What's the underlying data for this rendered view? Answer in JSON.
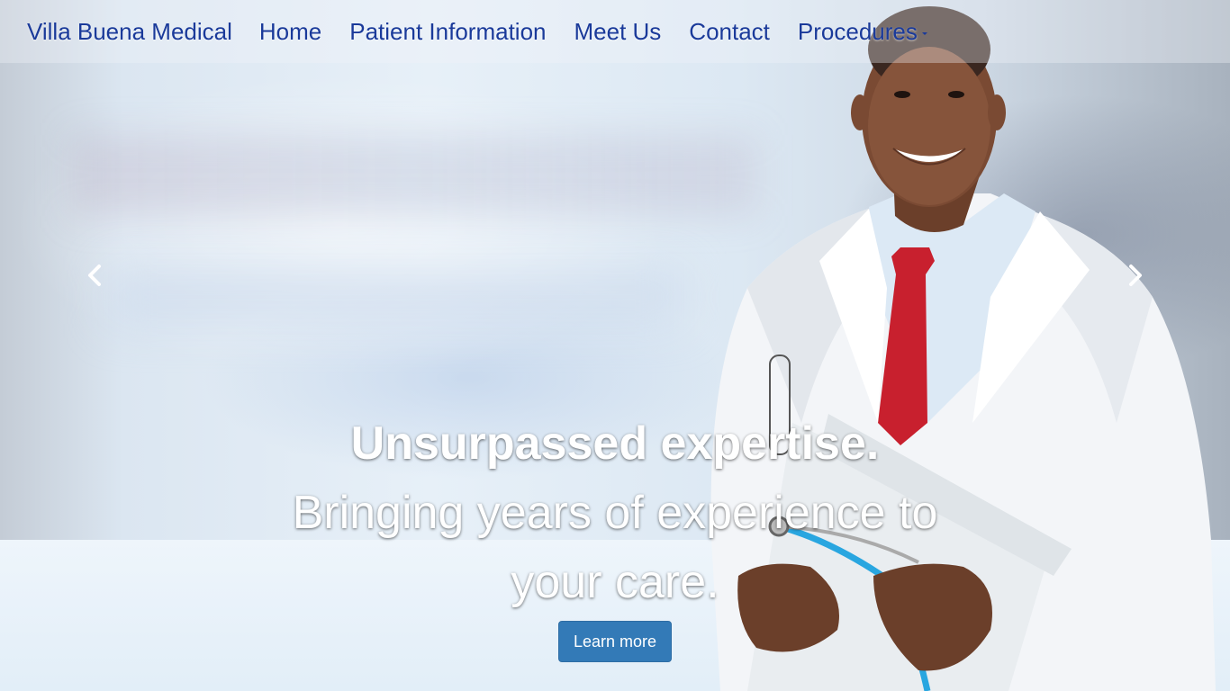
{
  "navbar": {
    "brand": "Villa Buena Medical",
    "links": [
      "Home",
      "Patient Information",
      "Meet Us",
      "Contact"
    ],
    "dropdown_label": "Procedures"
  },
  "carousel": {
    "caption_line1": "Unsurpassed expertise.",
    "caption_line2": "Bringing years of experience to your care.",
    "button_label": "Learn more",
    "prev_icon": "chevron-left-icon",
    "next_icon": "chevron-right-icon"
  },
  "colors": {
    "nav_text": "#1a3a9a",
    "button_bg": "#337ab7",
    "caption_text": "#ffffff"
  }
}
